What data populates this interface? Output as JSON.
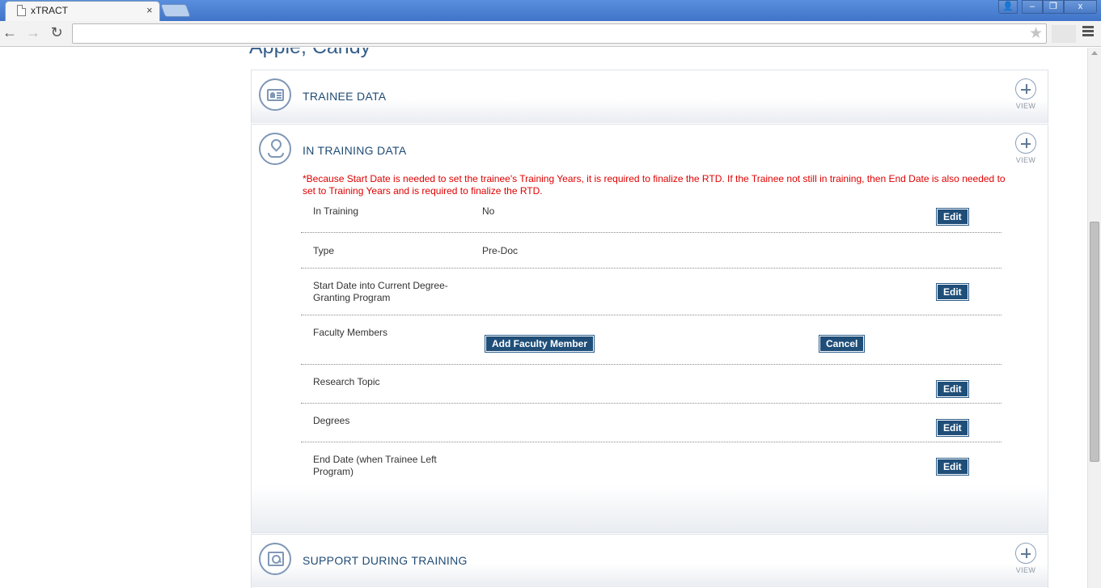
{
  "browser": {
    "tab_title": "xTRACT",
    "tab_close": "×",
    "window_controls": {
      "user": "👤",
      "minimize": "–",
      "maximize": "❐",
      "close": "x"
    },
    "nav": {
      "back": "←",
      "forward": "→",
      "reload": "↻"
    },
    "address": "",
    "star": "★"
  },
  "page": {
    "person_name": "Apple, Candy",
    "panels": {
      "trainee": {
        "title": "TRAINEE DATA",
        "view_label": "VIEW"
      },
      "in_training": {
        "title": "IN TRAINING DATA",
        "view_label": "VIEW",
        "notice": "*Because Start Date is needed to set the trainee's Training Years, it is required to finalize the RTD. If the Trainee not still in training, then End Date is also needed to set to Training Years and is required to finalize the RTD.",
        "rows": [
          {
            "label": "In Training",
            "value": "No",
            "button": "Edit"
          },
          {
            "label": "Type",
            "value": "Pre-Doc"
          },
          {
            "label": "Start Date into Current Degree-Granting Program",
            "button": "Edit"
          },
          {
            "label": "Faculty Members",
            "add_button": "Add Faculty Member",
            "cancel_button": "Cancel"
          },
          {
            "label": "Research Topic",
            "button": "Edit"
          },
          {
            "label": "Degrees",
            "button": "Edit"
          },
          {
            "label": "End Date (when Trainee Left Program)",
            "button": "Edit"
          }
        ]
      },
      "support": {
        "title": "SUPPORT DURING TRAINING",
        "view_label": "VIEW"
      }
    }
  }
}
